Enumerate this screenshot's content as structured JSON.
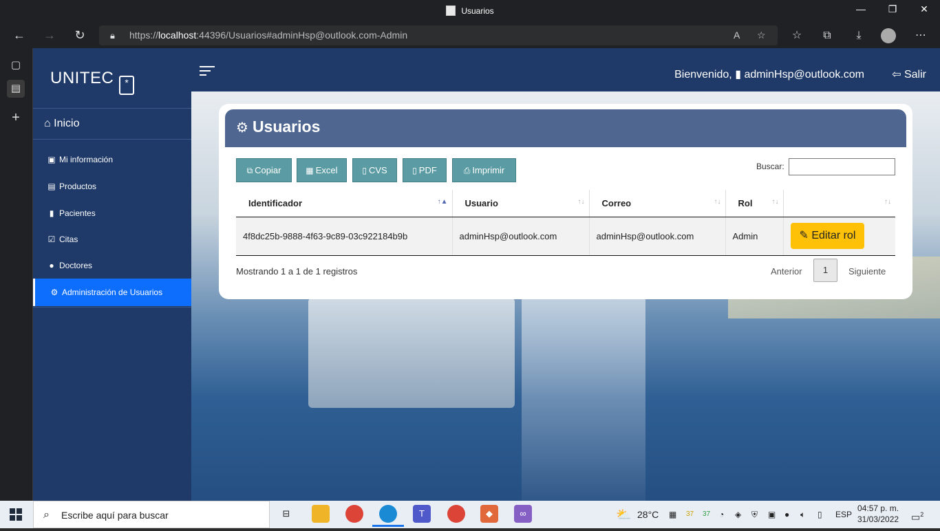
{
  "browser": {
    "window_title": "Usuarios",
    "url_prefix": "https://",
    "url_host": "localhost",
    "url_rest": ":44396/Usuarios#adminHsp@outlook.com-Admin"
  },
  "sidebar": {
    "brand": "UNITEC",
    "home_label": "Inicio",
    "items": [
      {
        "label": "Mi información",
        "icon": "id-card-icon"
      },
      {
        "label": "Productos",
        "icon": "box-icon"
      },
      {
        "label": "Pacientes",
        "icon": "patient-icon"
      },
      {
        "label": "Citas",
        "icon": "calendar-check-icon"
      },
      {
        "label": "Doctores",
        "icon": "users-icon"
      },
      {
        "label": "Administración de Usuarios",
        "icon": "users-cog-icon"
      }
    ]
  },
  "topbar": {
    "welcome": "Bienvenido,",
    "user": "adminHsp@outlook.com",
    "logout": "Salir"
  },
  "card": {
    "title": "Usuarios",
    "buttons": [
      "Copiar",
      "Excel",
      "CVS",
      "PDF",
      "Imprimir"
    ],
    "search_label": "Buscar:",
    "search_value": "",
    "columns": [
      "Identificador",
      "Usuario",
      "Correo",
      "Rol",
      ""
    ],
    "rows": [
      {
        "id": "4f8dc25b-9888-4f63-9c89-03c922184b9b",
        "usuario": "adminHsp@outlook.com",
        "correo": "adminHsp@outlook.com",
        "rol": "Admin",
        "action": "Editar rol"
      }
    ],
    "info": "Mostrando 1 a 1 de 1 registros",
    "prev": "Anterior",
    "page": "1",
    "next": "Siguiente"
  },
  "taskbar": {
    "search_placeholder": "Escribe aquí para buscar",
    "weather": "28°C",
    "badge1": "37",
    "badge2": "37",
    "lang": "ESP",
    "time": "04:57 p. m.",
    "date": "31/03/2022",
    "notifications": "2"
  }
}
